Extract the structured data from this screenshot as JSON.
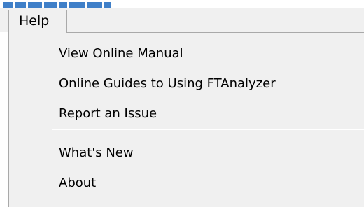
{
  "colors": {
    "menu_bg": "#f0f0f0",
    "border": "#a9a9a9",
    "accent": "#2c6fbb"
  },
  "menubar": {
    "help_label": "Help"
  },
  "help_menu": {
    "items": [
      {
        "label": "View Online Manual"
      },
      {
        "label": "Online Guides to Using FTAnalyzer"
      },
      {
        "label": "Report an Issue"
      },
      {
        "label": "What's New"
      },
      {
        "label": "About"
      }
    ]
  }
}
